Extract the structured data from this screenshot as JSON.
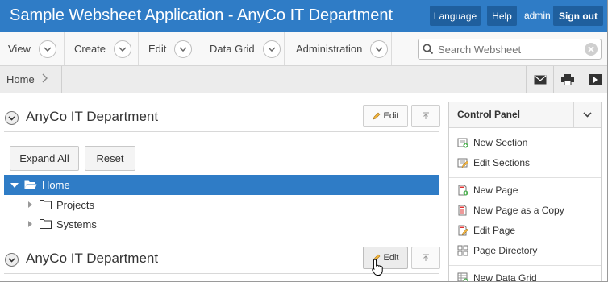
{
  "header": {
    "title": "Sample Websheet Application - AnyCo IT Department",
    "language_label": "Language",
    "help_label": "Help",
    "user": "admin",
    "signout_label": "Sign out"
  },
  "menu": {
    "items": [
      {
        "label": "View"
      },
      {
        "label": "Create"
      },
      {
        "label": "Edit"
      },
      {
        "label": "Data Grid"
      },
      {
        "label": "Administration"
      }
    ],
    "search_placeholder": "Search Websheet"
  },
  "breadcrumb": {
    "home": "Home"
  },
  "main": {
    "sections": [
      {
        "title": "AnyCo IT Department",
        "edit_label": "Edit"
      },
      {
        "title": "AnyCo IT Department",
        "edit_label": "Edit"
      }
    ],
    "expand_all_label": "Expand All",
    "reset_label": "Reset",
    "tree": {
      "root": "Home",
      "children": [
        "Projects",
        "Systems"
      ]
    }
  },
  "control_panel": {
    "title": "Control Panel",
    "items": [
      "New Section",
      "Edit Sections",
      "New Page",
      "New Page as a Copy",
      "Edit Page",
      "Page Directory",
      "New Data Grid"
    ]
  },
  "colors": {
    "brand": "#2f7cc6",
    "brand_dark": "#1f5f9e"
  }
}
